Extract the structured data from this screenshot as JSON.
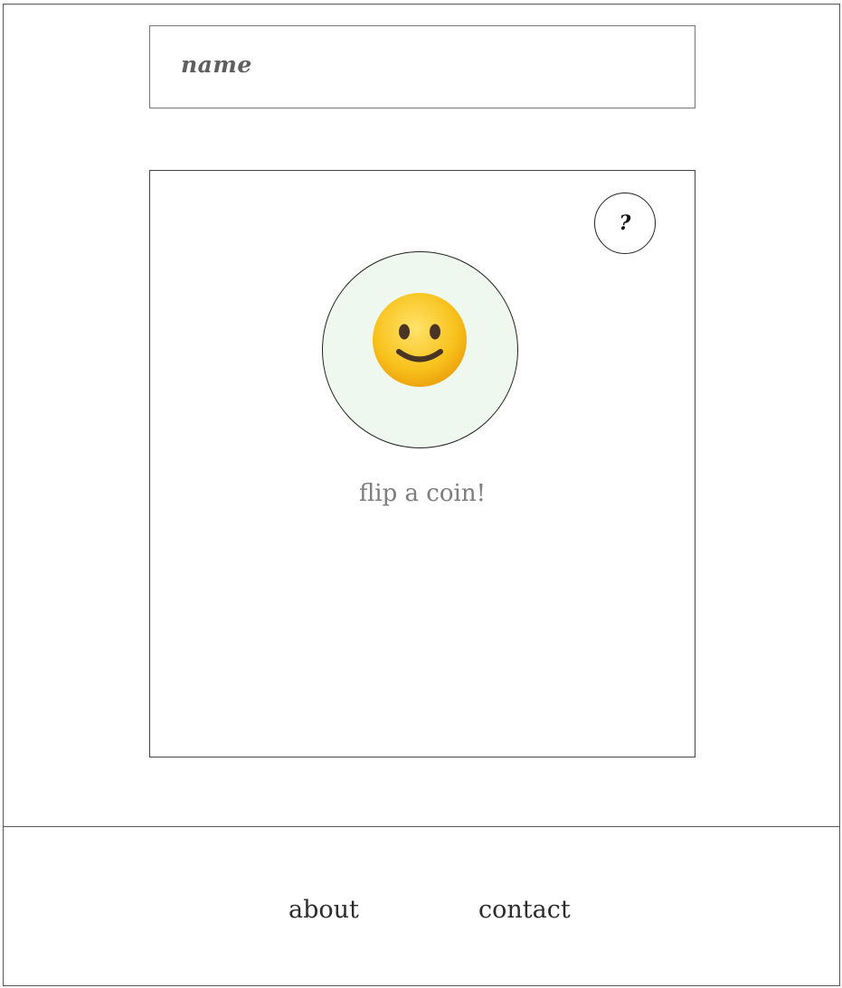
{
  "header": {
    "name_label": "name"
  },
  "card": {
    "help_button_label": "?",
    "coin_icon": "smiling-face-icon",
    "coin_background": "#eef8ee",
    "flip_label": "flip a coin!"
  },
  "footer": {
    "links": [
      {
        "label": "about"
      },
      {
        "label": "contact"
      }
    ]
  }
}
